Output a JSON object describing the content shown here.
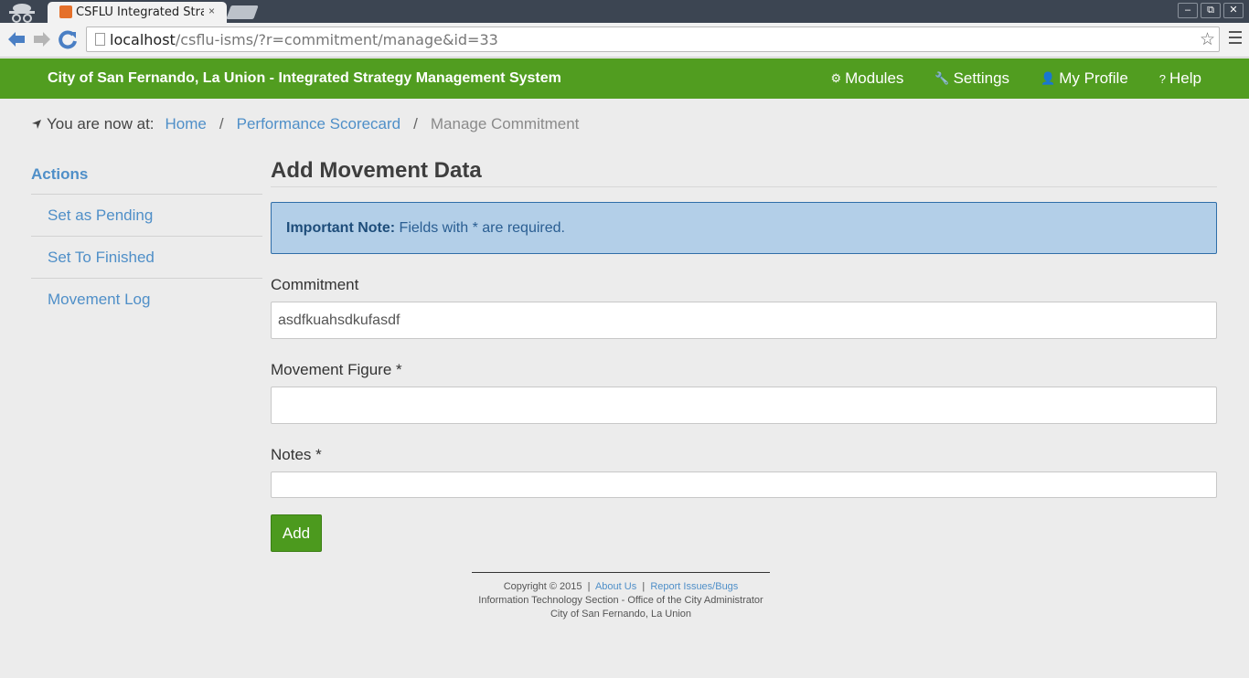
{
  "browser": {
    "tab_title": "CSFLU Integrated Strat",
    "tab_close": "×",
    "url_host": "localhost",
    "url_path": "/csflu-isms/?r=commitment/manage&id=33",
    "window_buttons": [
      "–",
      "⧉",
      "✕"
    ]
  },
  "navbar": {
    "brand": "City of San Fernando, La Union - Integrated Strategy Management System",
    "items": [
      {
        "label": "Modules",
        "icon": "cogs-icon",
        "glyph": "⚙"
      },
      {
        "label": "Settings",
        "icon": "wrench-icon",
        "glyph": "🔧"
      },
      {
        "label": "My Profile",
        "icon": "user-icon",
        "glyph": "👤"
      },
      {
        "label": "Help",
        "icon": "question-circle-icon",
        "glyph": "?"
      }
    ]
  },
  "breadcrumb": {
    "prefix": "You are now at:",
    "items": [
      "Home",
      "Performance Scorecard"
    ],
    "separator": "/",
    "current": "Manage Commitment"
  },
  "sidebar": {
    "title": "Actions",
    "items": [
      "Set as Pending",
      "Set To Finished",
      "Movement Log"
    ]
  },
  "main": {
    "heading": "Add Movement Data",
    "alert_strong": "Important Note:",
    "alert_text": " Fields with * are required.",
    "fields": {
      "commitment_label": "Commitment",
      "commitment_value": "asdfkuahsdkufasdf",
      "movement_label": "Movement Figure *",
      "movement_value": "",
      "notes_label": "Notes *",
      "notes_value": ""
    },
    "submit_label": "Add"
  },
  "footer": {
    "copyright": "Copyright © 2015",
    "about": "About Us",
    "report": "Report Issues/Bugs",
    "line2": "Information Technology Section - Office of the City Administrator",
    "line3": "City of San Fernando, La Union",
    "sep": "|"
  },
  "colors": {
    "navbar": "#519d20",
    "link": "#4f8fc8",
    "alert_bg": "#b3cfe8",
    "button": "#4c9a1e"
  }
}
